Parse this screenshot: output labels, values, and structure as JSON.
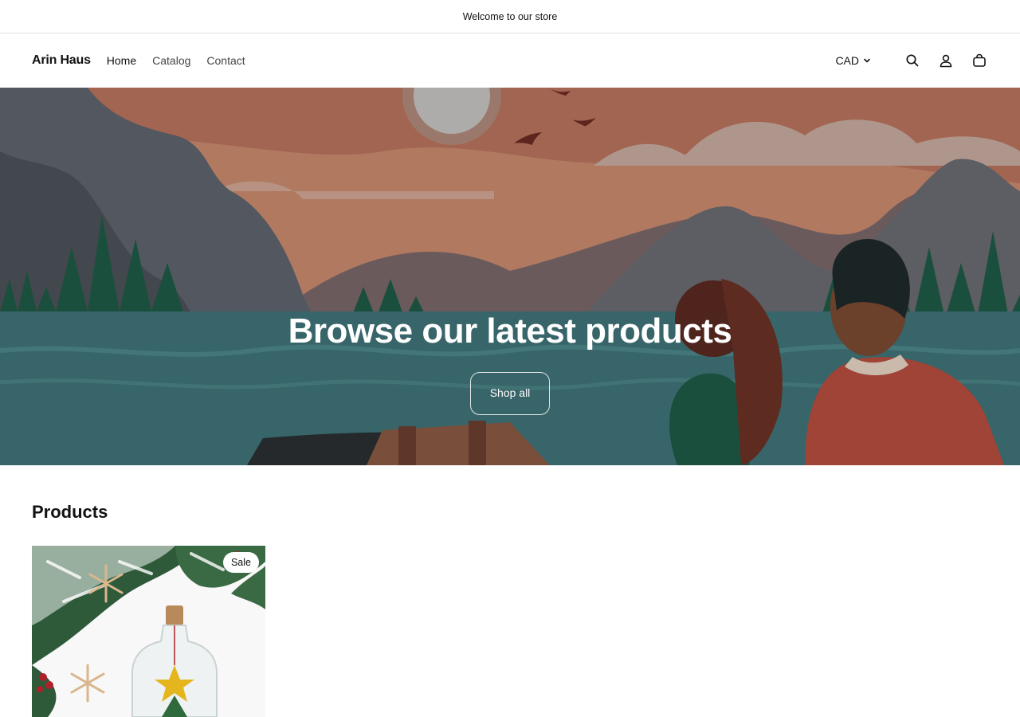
{
  "announcement": {
    "text": "Welcome to our store"
  },
  "header": {
    "logo": "Arin Haus",
    "nav": [
      {
        "label": "Home",
        "active": true
      },
      {
        "label": "Catalog",
        "active": false
      },
      {
        "label": "Contact",
        "active": false
      }
    ],
    "currency": "CAD",
    "icons": [
      "search-icon",
      "account-icon",
      "cart-icon"
    ]
  },
  "hero": {
    "title": "Browse our latest products",
    "button_label": "Shop all"
  },
  "products": {
    "heading": "Products",
    "items": [
      {
        "badge": "Sale"
      }
    ]
  },
  "colors": {
    "text": "#121212",
    "overlay": "#000000",
    "sky": "#c98a6e",
    "water": "#3f7378"
  }
}
